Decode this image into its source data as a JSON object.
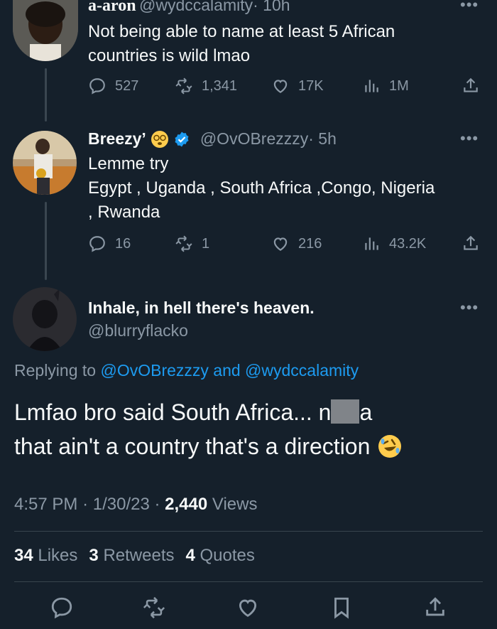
{
  "tweet1": {
    "display_name": "a-aron",
    "handle": "@wydccalamity",
    "time": "· 10h",
    "text": "Not being able to name at least 5 African countries is wild lmao",
    "replies": "527",
    "retweets": "1,341",
    "likes": "17K",
    "views": "1M"
  },
  "tweet2": {
    "display_name": "Breezy’",
    "handle": "@OvOBrezzzy",
    "time": "· 5h",
    "text_line1": "Lemme try",
    "text_line2": "Egypt , Uganda , South Africa ,Congo, Nigeria",
    "text_line3": ", Rwanda",
    "replies": "16",
    "retweets": "1",
    "likes": "216",
    "views": "43.2K"
  },
  "main_tweet": {
    "display_name": "Inhale, in hell there's heaven.",
    "handle": "@blurryflacko",
    "replying_prefix": "Replying to",
    "replying_to_1": "@OvOBrezzzy",
    "replying_and": "and",
    "replying_to_2": "@wydccalamity",
    "text_part1": "Lmfao bro said South Africa... n",
    "text_part2": "a",
    "text_line2": "that ain't a country that's a direction",
    "time": "4:57 PM",
    "date": "1/30/23",
    "views_count": "2,440",
    "views_label": "Views",
    "likes_count": "34",
    "likes_label": "Likes",
    "retweets_count": "3",
    "retweets_label": "Retweets",
    "quotes_count": "4",
    "quotes_label": "Quotes"
  },
  "colors": {
    "background": "#15202b",
    "muted": "#8b98a5",
    "accent": "#1d9bf0",
    "divider": "#38444d"
  },
  "icons": [
    "reply-icon",
    "retweet-icon",
    "like-icon",
    "views-icon",
    "share-icon",
    "bookmark-icon",
    "verified-badge-icon",
    "dizzy-face-emoji-icon",
    "rofl-emoji-icon"
  ]
}
